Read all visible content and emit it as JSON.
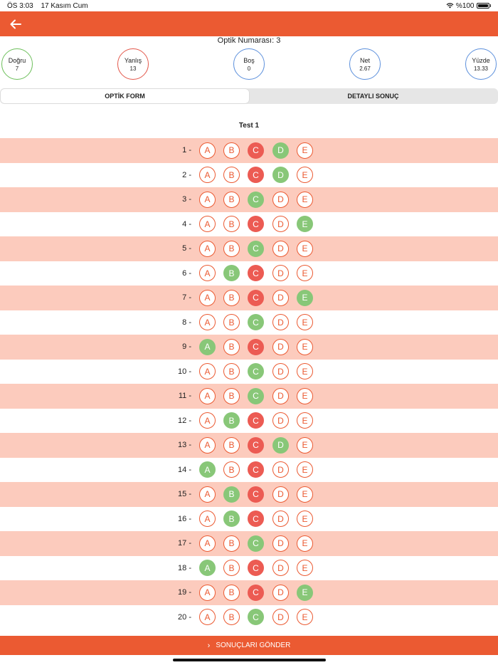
{
  "status_bar": {
    "time": "ÖS 3:03",
    "date": "17 Kasım Cum",
    "battery": "%100"
  },
  "header": {
    "back_icon": "arrow-left-icon"
  },
  "optic_number": "Optik Numarası: 3",
  "stats": {
    "correct": {
      "label": "Doğru",
      "value": "7"
    },
    "wrong": {
      "label": "Yanlış",
      "value": "13"
    },
    "empty": {
      "label": "Boş",
      "value": "0"
    },
    "net": {
      "label": "Net",
      "value": "2.67"
    },
    "percent": {
      "label": "Yüzde",
      "value": "13.33"
    }
  },
  "tabs": {
    "optic_form": "OPTİK FORM",
    "detailed_result": "DETAYLI SONUÇ",
    "active": "optic_form"
  },
  "test_title": "Test 1",
  "option_letters": [
    "A",
    "B",
    "C",
    "D",
    "E"
  ],
  "questions": [
    {
      "number": "1 -",
      "correct": "D",
      "marked": "C"
    },
    {
      "number": "2 -",
      "correct": "D",
      "marked": "C"
    },
    {
      "number": "3 -",
      "correct": "C",
      "marked": null
    },
    {
      "number": "4 -",
      "correct": "E",
      "marked": "C"
    },
    {
      "number": "5 -",
      "correct": "C",
      "marked": null
    },
    {
      "number": "6 -",
      "correct": "B",
      "marked": "C"
    },
    {
      "number": "7 -",
      "correct": "E",
      "marked": "C"
    },
    {
      "number": "8 -",
      "correct": "C",
      "marked": null
    },
    {
      "number": "9 -",
      "correct": "A",
      "marked": "C"
    },
    {
      "number": "10 -",
      "correct": "C",
      "marked": null
    },
    {
      "number": "11 -",
      "correct": "C",
      "marked": null
    },
    {
      "number": "12 -",
      "correct": "B",
      "marked": "C"
    },
    {
      "number": "13 -",
      "correct": "D",
      "marked": "C"
    },
    {
      "number": "14 -",
      "correct": "A",
      "marked": "C"
    },
    {
      "number": "15 -",
      "correct": "B",
      "marked": "C"
    },
    {
      "number": "16 -",
      "correct": "B",
      "marked": "C"
    },
    {
      "number": "17 -",
      "correct": "C",
      "marked": null
    },
    {
      "number": "18 -",
      "correct": "A",
      "marked": "C"
    },
    {
      "number": "19 -",
      "correct": "E",
      "marked": "C"
    },
    {
      "number": "20 -",
      "correct": "C",
      "marked": null
    }
  ],
  "submit": {
    "label": "SONUÇLARI GÖNDER"
  },
  "colors": {
    "accent": "#eb5a32",
    "correct": "#88c778",
    "wrong": "#ec5b53",
    "row_alt": "#fccbbd"
  }
}
